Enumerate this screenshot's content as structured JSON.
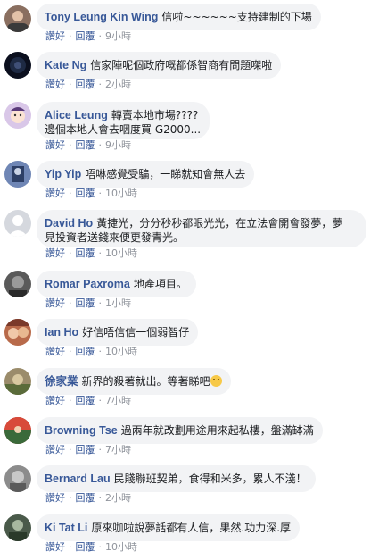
{
  "comments": [
    {
      "name": "Tony Leung Kin Wing",
      "text": "信啦~~~~~~支持建制的下場",
      "like": "讚好",
      "reply": "回覆",
      "time": "9小時",
      "avatar_color": "#8a6f60"
    },
    {
      "name": "Kate Ng",
      "text": "信家陣呢個政府嘅都係智商有問題㗎啦",
      "like": "讚好",
      "reply": "回覆",
      "time": "2小時",
      "avatar_color": "#0b0f1e"
    },
    {
      "name": "Alice Leung",
      "text": "轉賣本地市場????",
      "text2": "邊個本地人會去咽度買 G2000...",
      "like": "讚好",
      "reply": "回覆",
      "time": "9小時",
      "avatar_color": "#d9c7e8"
    },
    {
      "name": "Yip Yip",
      "text": "唔啉感覺受騙，一睇就知會無人去",
      "like": "讚好",
      "reply": "回覆",
      "time": "10小時",
      "avatar_color": "#6f86b5"
    },
    {
      "name": "David Ho",
      "text": "黃捷光，分分秒秒都眼光光，在立法會開會發夢，夢",
      "text2": "見投資者送錢來便更發青光。",
      "like": "讚好",
      "reply": "回覆",
      "time": "10小時",
      "avatar_color": "#d5d8de"
    },
    {
      "name": "Romar Paxroma",
      "text": "地產項目。",
      "like": "讚好",
      "reply": "回覆",
      "time": "1小時",
      "avatar_color": "#5a5a5a"
    },
    {
      "name": "Ian Ho",
      "text": "好信唔信信一個弱智仔",
      "like": "讚好",
      "reply": "回覆",
      "time": "10小時",
      "avatar_color": "#b86a4a"
    },
    {
      "name": "徐家業",
      "text": "新界的殺著就出。等著睇吧",
      "like": "讚好",
      "reply": "回覆",
      "time": "7小時",
      "avatar_color": "#9b8c6b"
    },
    {
      "name": "Browning Tse",
      "text": "過兩年就改劃用途用來起私樓，盤滿缽滿",
      "like": "讚好",
      "reply": "回覆",
      "time": "7小時",
      "avatar_color": "#a63a2e"
    },
    {
      "name": "Bernard Lau",
      "text": "民賤聯班契弟，食得和米多，累人不淺！",
      "like": "讚好",
      "reply": "回覆",
      "time": "2小時",
      "avatar_color": "#8c8c8c"
    },
    {
      "name": "Ki Tat Li",
      "text": "原來咖啦說夢話都有人信，果然.功力深.厚",
      "like": "讚好",
      "reply": "回覆",
      "time": "10小時",
      "avatar_color": "#4a5a4a"
    }
  ],
  "icons": {
    "emoji": "smiling-face-icon"
  }
}
